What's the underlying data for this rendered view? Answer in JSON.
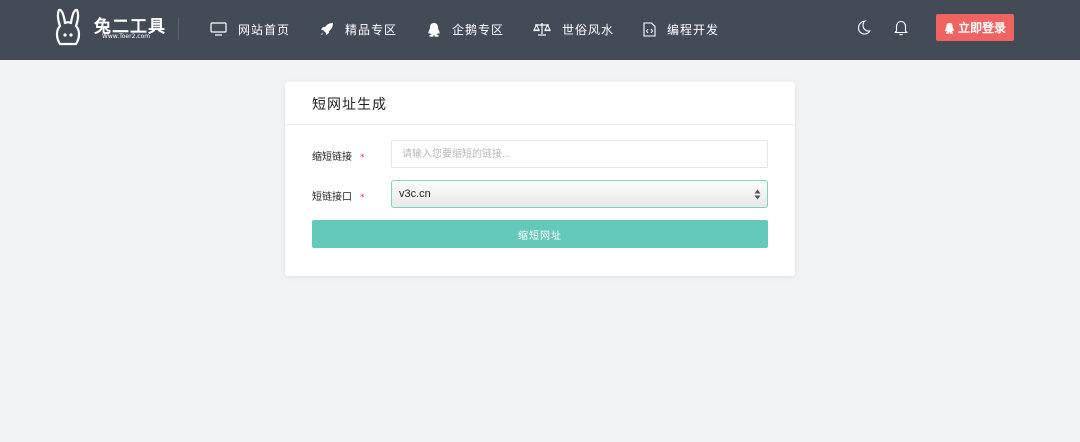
{
  "header": {
    "logo_text": "兔二工具",
    "logo_sub": "Www.Toer2.com",
    "nav": [
      {
        "label": "网站首页",
        "icon": "monitor-icon"
      },
      {
        "label": "精品专区",
        "icon": "rocket-icon"
      },
      {
        "label": "企鹅专区",
        "icon": "penguin-icon"
      },
      {
        "label": "世俗风水",
        "icon": "scale-icon"
      },
      {
        "label": "编程开发",
        "icon": "code-file-icon"
      }
    ],
    "icons": [
      "moon-icon",
      "bell-icon"
    ],
    "login_label": "立即登录",
    "colors": {
      "bar": "#434b57",
      "login": "#ef6461"
    }
  },
  "form": {
    "title": "短网址生成",
    "url_label": "缩短链接",
    "url_placeholder": "请输入您要缩短的链接...",
    "url_value": "",
    "api_label": "短链接口",
    "api_value": "v3c.cn",
    "required_mark": "*",
    "submit_label": "缩短网址",
    "colors": {
      "accent": "#64c9bb",
      "required": "#e4393c"
    }
  }
}
